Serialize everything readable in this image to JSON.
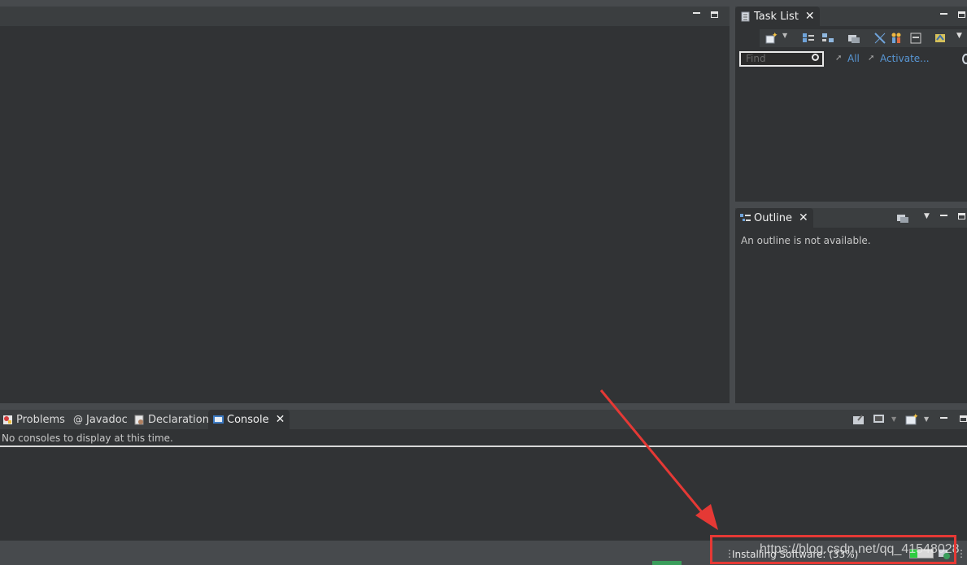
{
  "editor_area": {},
  "task_list": {
    "tab_label": "Task List",
    "find_placeholder": "Find",
    "filter_all": "All",
    "filter_activate": "Activate..."
  },
  "outline": {
    "tab_label": "Outline",
    "empty_message": "An outline is not available."
  },
  "bottom_panel": {
    "tabs": [
      {
        "label": "Problems",
        "icon": "problems-icon"
      },
      {
        "label": "Javadoc",
        "icon": "at-icon"
      },
      {
        "label": "Declaration",
        "icon": "declaration-icon"
      },
      {
        "label": "Console",
        "icon": "console-icon"
      }
    ],
    "active_tab": "Console",
    "console_message": "No consoles to display at this time."
  },
  "status_bar": {
    "progress_text": "Installing Software: (33%)",
    "progress_percent": 33,
    "watermark": "https://blog.csdn.net/qq_41548028"
  },
  "colors": {
    "background": "#474a4d",
    "panel": "#313335",
    "link": "#5896d4",
    "annotation_red": "#e53935",
    "progress_green": "#2ecc40"
  }
}
